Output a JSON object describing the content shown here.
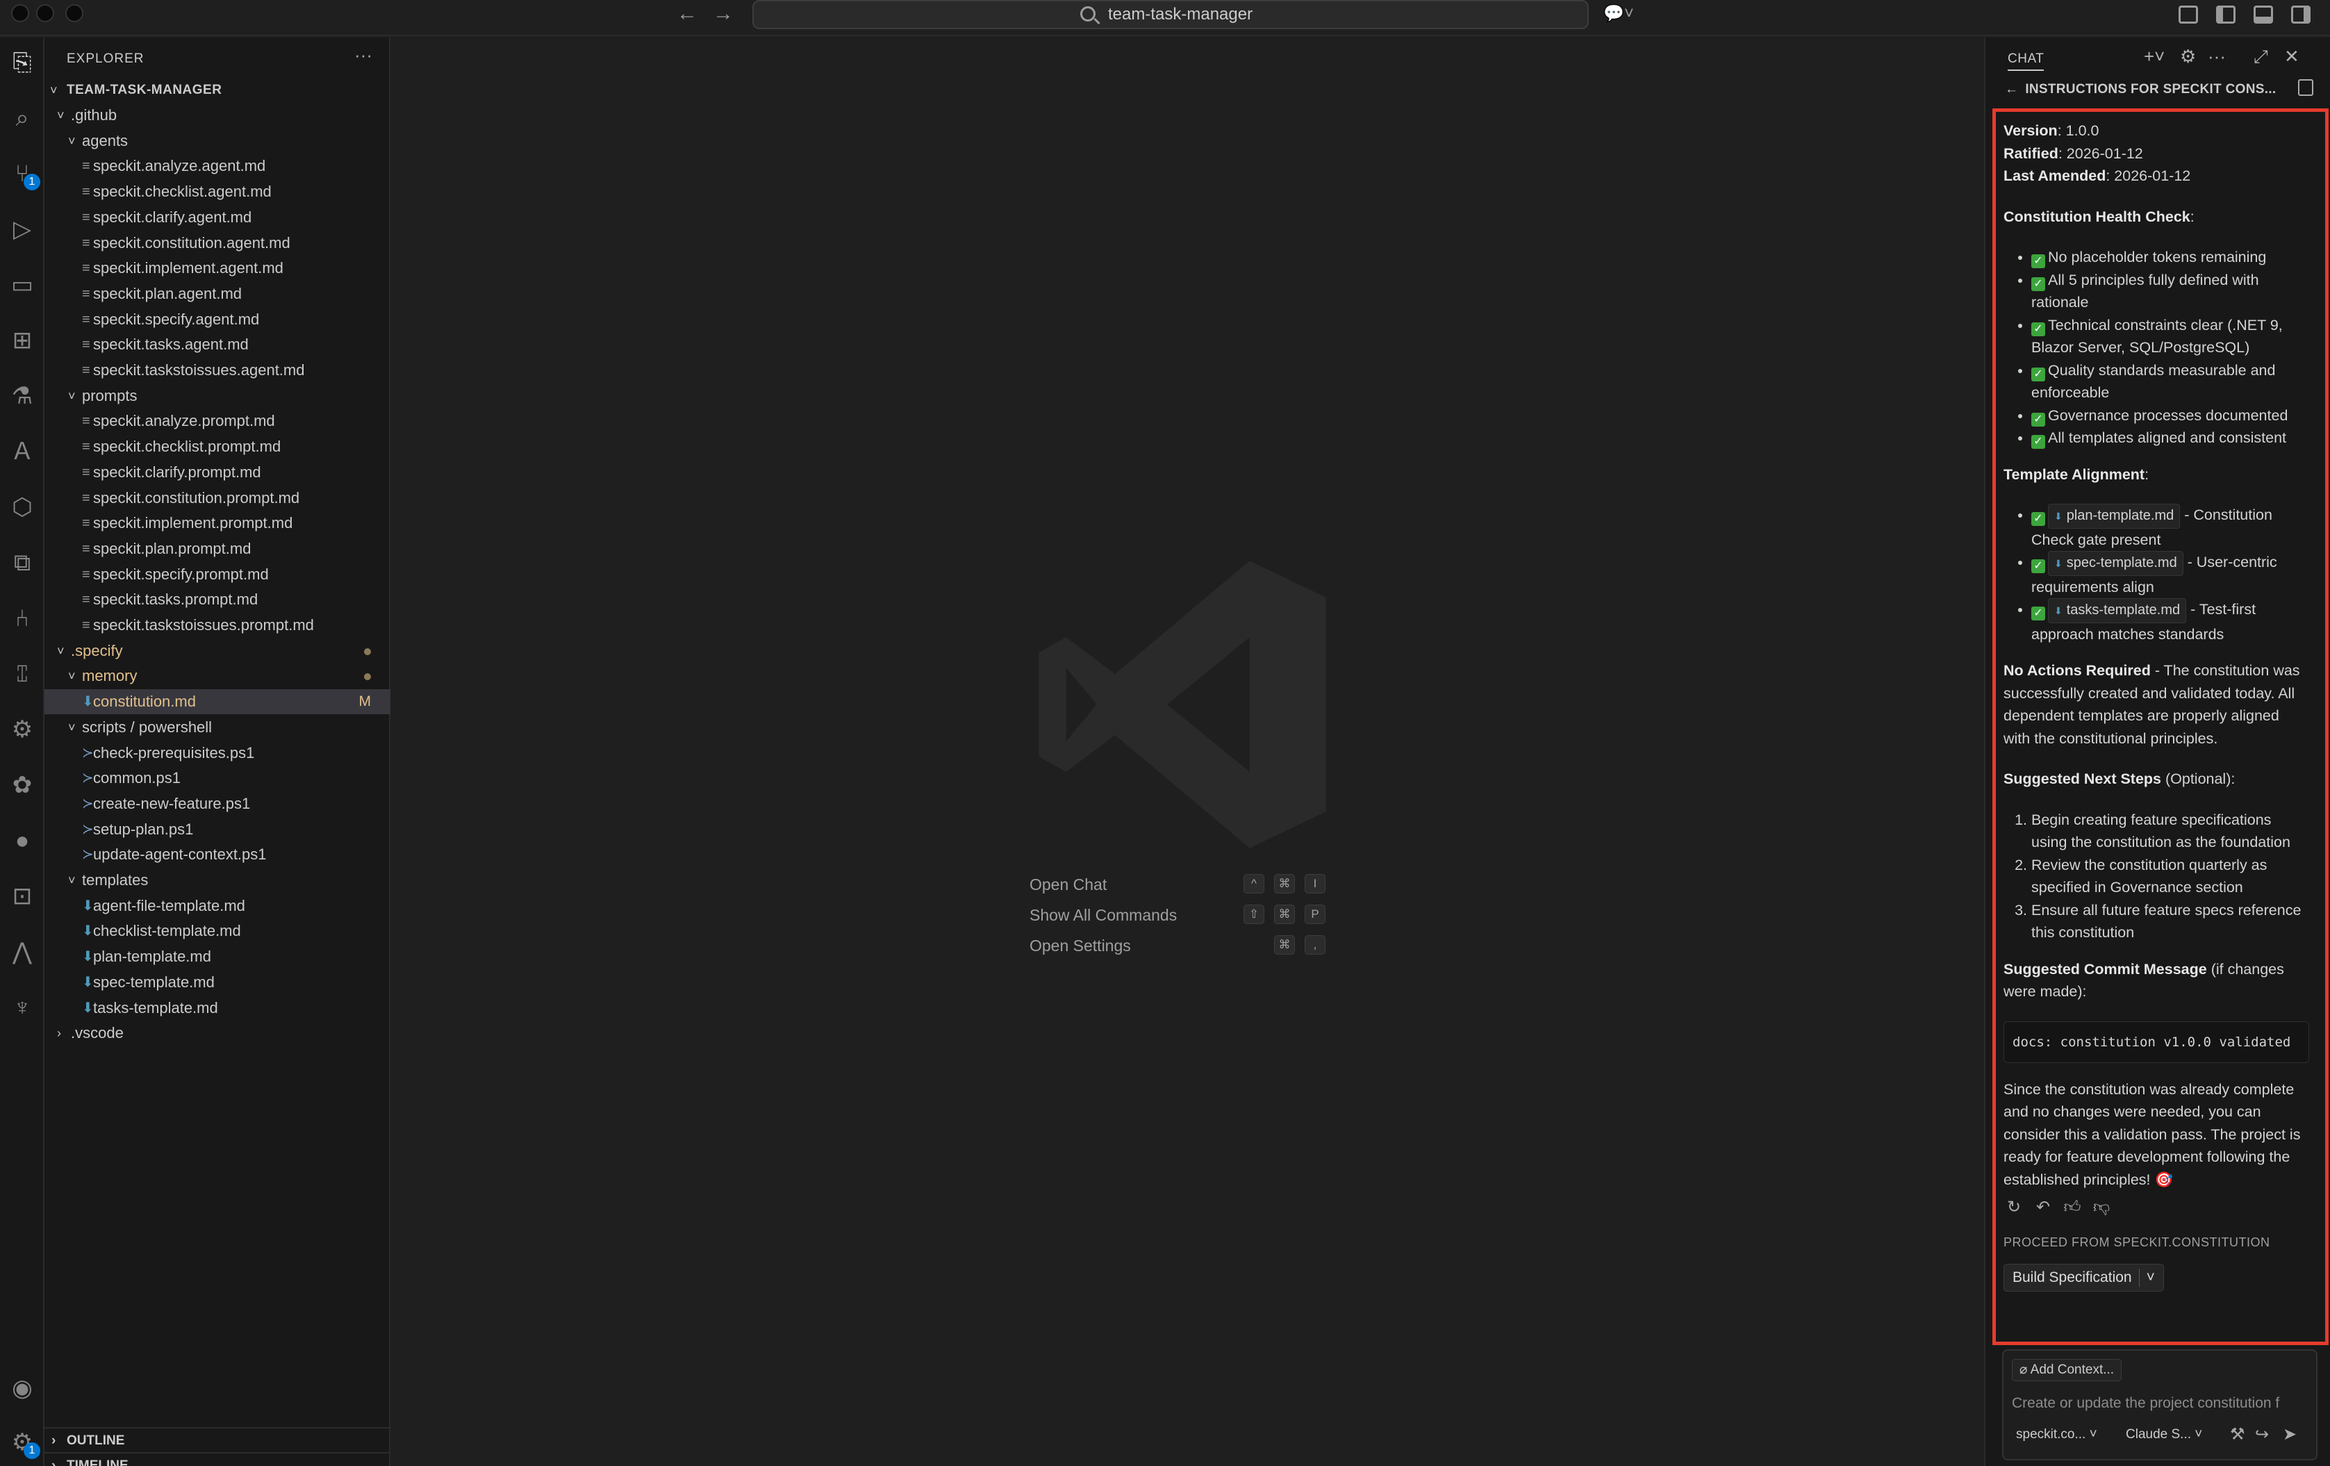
{
  "titlebar": {
    "search_text": "team-task-manager"
  },
  "explorer": {
    "header": "EXPLORER",
    "root": "TEAM-TASK-MANAGER",
    "items": [
      {
        "label": ".github",
        "kind": "folder",
        "depth": 0,
        "open": true
      },
      {
        "label": "agents",
        "kind": "folder",
        "depth": 1,
        "open": true
      },
      {
        "label": "speckit.analyze.agent.md",
        "kind": "file",
        "depth": 2
      },
      {
        "label": "speckit.checklist.agent.md",
        "kind": "file",
        "depth": 2
      },
      {
        "label": "speckit.clarify.agent.md",
        "kind": "file",
        "depth": 2
      },
      {
        "label": "speckit.constitution.agent.md",
        "kind": "file",
        "depth": 2
      },
      {
        "label": "speckit.implement.agent.md",
        "kind": "file",
        "depth": 2
      },
      {
        "label": "speckit.plan.agent.md",
        "kind": "file",
        "depth": 2
      },
      {
        "label": "speckit.specify.agent.md",
        "kind": "file",
        "depth": 2
      },
      {
        "label": "speckit.tasks.agent.md",
        "kind": "file",
        "depth": 2
      },
      {
        "label": "speckit.taskstoissues.agent.md",
        "kind": "file",
        "depth": 2
      },
      {
        "label": "prompts",
        "kind": "folder",
        "depth": 1,
        "open": true
      },
      {
        "label": "speckit.analyze.prompt.md",
        "kind": "file",
        "depth": 2
      },
      {
        "label": "speckit.checklist.prompt.md",
        "kind": "file",
        "depth": 2
      },
      {
        "label": "speckit.clarify.prompt.md",
        "kind": "file",
        "depth": 2
      },
      {
        "label": "speckit.constitution.prompt.md",
        "kind": "file",
        "depth": 2
      },
      {
        "label": "speckit.implement.prompt.md",
        "kind": "file",
        "depth": 2
      },
      {
        "label": "speckit.plan.prompt.md",
        "kind": "file",
        "depth": 2
      },
      {
        "label": "speckit.specify.prompt.md",
        "kind": "file",
        "depth": 2
      },
      {
        "label": "speckit.tasks.prompt.md",
        "kind": "file",
        "depth": 2
      },
      {
        "label": "speckit.taskstoissues.prompt.md",
        "kind": "file",
        "depth": 2
      },
      {
        "label": ".specify",
        "kind": "folder",
        "depth": 0,
        "open": true,
        "modified": true
      },
      {
        "label": "memory",
        "kind": "folder",
        "depth": 1,
        "open": true,
        "modified": true
      },
      {
        "label": "constitution.md",
        "kind": "md",
        "depth": 2,
        "modified": true,
        "selected": true,
        "flag": "M"
      },
      {
        "label": "scripts / powershell",
        "kind": "folder",
        "depth": 1,
        "open": true
      },
      {
        "label": "check-prerequisites.ps1",
        "kind": "ps",
        "depth": 2
      },
      {
        "label": "common.ps1",
        "kind": "ps",
        "depth": 2
      },
      {
        "label": "create-new-feature.ps1",
        "kind": "ps",
        "depth": 2
      },
      {
        "label": "setup-plan.ps1",
        "kind": "ps",
        "depth": 2
      },
      {
        "label": "update-agent-context.ps1",
        "kind": "ps",
        "depth": 2
      },
      {
        "label": "templates",
        "kind": "folder",
        "depth": 1,
        "open": true
      },
      {
        "label": "agent-file-template.md",
        "kind": "md",
        "depth": 2
      },
      {
        "label": "checklist-template.md",
        "kind": "md",
        "depth": 2
      },
      {
        "label": "plan-template.md",
        "kind": "md",
        "depth": 2
      },
      {
        "label": "spec-template.md",
        "kind": "md",
        "depth": 2
      },
      {
        "label": "tasks-template.md",
        "kind": "md",
        "depth": 2
      },
      {
        "label": ".vscode",
        "kind": "folder",
        "depth": 0,
        "open": false
      }
    ],
    "outline": "OUTLINE",
    "timeline": "TIMELINE"
  },
  "activity": {
    "scm_badge": "1",
    "settings_badge": "1"
  },
  "editor": {
    "hints": [
      {
        "label": "Open Chat",
        "keys": [
          "^",
          "⌘",
          "I"
        ]
      },
      {
        "label": "Show All Commands",
        "keys": [
          "⇧",
          "⌘",
          "P"
        ]
      },
      {
        "label": "Open Settings",
        "keys": [
          "⌘",
          ","
        ]
      }
    ]
  },
  "chat": {
    "title": "CHAT",
    "subheader": "INSTRUCTIONS FOR SPECKIT CONS...",
    "version_label": "Version",
    "version": ": 1.0.0",
    "ratified_label": "Ratified",
    "ratified": ": 2026-01-12",
    "amended_label": "Last Amended",
    "amended": ": 2026-01-12",
    "health_title": "Constitution Health Check",
    "health_items": [
      "No placeholder tokens remaining",
      "All 5 principles fully defined with rationale",
      "Technical constraints clear (.NET 9, Blazor Server, SQL/PostgreSQL)",
      "Quality standards measurable and enforceable",
      "Governance processes documented",
      "All templates aligned and consistent"
    ],
    "alignment_title": "Template Alignment",
    "alignment_items": [
      {
        "file": "plan-template.md",
        "note": " - Constitution Check gate present"
      },
      {
        "file": "spec-template.md",
        "note": " - User-centric requirements align"
      },
      {
        "file": "tasks-template.md",
        "note": " - Test-first approach matches standards"
      }
    ],
    "no_actions_bold": "No Actions Required",
    "no_actions_text": " - The constitution was successfully created and validated today. All dependent templates are properly aligned with the constitutional principles.",
    "next_steps_bold": "Suggested Next Steps",
    "next_steps_suffix": " (Optional):",
    "next_steps": [
      "Begin creating feature specifications using the constitution as the foundation",
      "Review the constitution quarterly as specified in Governance section",
      "Ensure all future feature specs reference this constitution"
    ],
    "commit_bold": "Suggested Commit Message",
    "commit_suffix": " (if changes were made):",
    "commit_code": "docs: constitution v1.0.0 validated",
    "closing": "Since the constitution was already complete and no changes were needed, you can consider this a validation pass. The project is ready for feature development following the established principles! 🎯",
    "proceed_label": "PROCEED FROM SPECKIT.CONSTITUTION",
    "build_button": "Build Specification",
    "add_context": "Add Context...",
    "input_placeholder": "Create or update the project constitution f",
    "agent_picker": "speckit.co...",
    "model_picker": "Claude S..."
  }
}
